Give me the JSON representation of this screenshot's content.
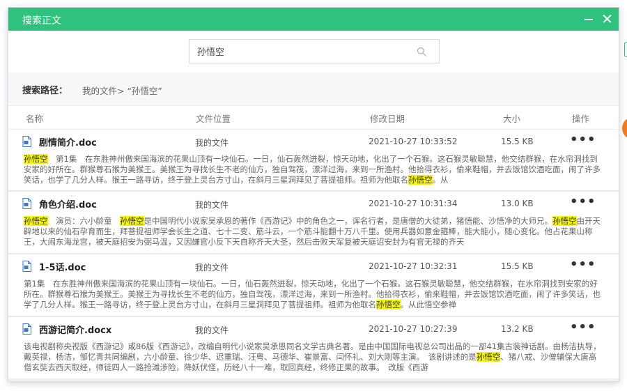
{
  "dialog": {
    "title": "搜索正文",
    "accent": "#2fc27e"
  },
  "search": {
    "value": "孙悟空",
    "placeholder": ""
  },
  "path": {
    "label": "搜索路径：",
    "value": "我的文件> “孙悟空”"
  },
  "columns": {
    "name": "名称",
    "location": "文件位置",
    "date": "修改日期",
    "size": "大小",
    "ops": "操作"
  },
  "highlight_color": "#f5f500",
  "rows": [
    {
      "name": "剧情简介.doc",
      "location": "我的文件",
      "date": "2021-10-27 10:33:52",
      "size": "15.5 KB",
      "more": "•••",
      "snippet": [
        {
          "hl": true,
          "t": "孙悟空"
        },
        {
          "hl": false,
          "t": "　第1集　在东胜神州傲来国海滨的花果山顶有一块仙石。一日，仙石轰然迸裂，惊天动地，化出了一个石猴。这石猴灵敏聪慧，他交结群猴，在水帘洞找到安家的好所在。群猴尊石猴为美猴王。美猴王为寻找长生不老的仙方，独自驾筏，漂洋过海，来到一所渔村。他拾得衣衫，偷来鞋帽，并去饭馆饮酒吃面，闹了许多笑话，也学了几分人样。猴王一路寻访，终于登上灵台方寸山，在斜月三星洞拜见了菩提祖师。祖师为他取名"
        },
        {
          "hl": true,
          "t": "孙悟空"
        },
        {
          "hl": false,
          "t": "。从"
        }
      ]
    },
    {
      "name": "角色介绍.doc",
      "location": "我的文件",
      "date": "2021-10-27 10:31:34",
      "size": "13.0 KB",
      "more": "•••",
      "snippet": [
        {
          "hl": true,
          "t": "孙悟空"
        },
        {
          "hl": false,
          "t": "　演员：六小龄童　"
        },
        {
          "hl": true,
          "t": "孙悟空"
        },
        {
          "hl": false,
          "t": "是中国明代小说家吴承恩的著作《西游记》中的角色之一，诨名行者，是唐僧的大徒弟，猪悟能、沙悟净的大师兄。"
        },
        {
          "hl": true,
          "t": "孙悟空"
        },
        {
          "hl": false,
          "t": "由开天辟地以来的仙石孕育而生，拜菩提祖师学会长生之道、七十二变、筋斗云，一个筋斗能翻十万八千里。使用兵器如意金箍棒，能大能小，随心变化。他占花果山称王，大闹东海龙宫，被天庭招安为弼马温，又因嫌官小反下天自称齐天大圣，然后击败天军复被天庭诏安封为有官无禄的齐天"
        }
      ]
    },
    {
      "name": "1-5话.doc",
      "location": "我的文件",
      "date": "2021-10-27 10:32:31",
      "size": "15.5 KB",
      "more": "•••",
      "snippet": [
        {
          "hl": false,
          "t": "第1集　在东胜神州傲来国海滨的花果山顶有一块仙石。一日，仙石轰然迸裂，惊天动地，化出了一个石猴。这石猴灵敏聪慧，他交结群猴，在水帘洞找到安家的好所在。群猴尊石猴为美猴王。美猴王为寻找长生不老的仙方，独自驾筏，漂洋过海，来到一所渔村。他拾得衣衫，偷来鞋帽，并去饭馆饮酒吃面，闹了许多笑话，也学了几分人样。猴王一路寻访，终于登上灵台方寸山，在斜月三星洞拜见了菩提祖师。祖师为他取名"
        },
        {
          "hl": true,
          "t": "孙悟空"
        },
        {
          "hl": false,
          "t": "。从此悟空参禅"
        }
      ]
    },
    {
      "name": "西游记简介.docx",
      "location": "我的文件",
      "date": "2021-10-27 10:27:39",
      "size": "13.2 KB",
      "more": "•••",
      "snippet": [
        {
          "hl": false,
          "t": "该电视剧称央视版《西游记》或86版《西游记》，改编自明代小说家吴承恩同名文学古典名著。是由中国国际电视总公司出品的一部41集古装神话剧。由杨洁执导，戴英禄，杨洁，邹忆青共同编剧，六小龄童、徐少华、迟重瑞、汪粤、马德华、崔景富、闫怀礼、刘大刚等主演。　该剧讲述的是"
        },
        {
          "hl": true,
          "t": "孙悟空"
        },
        {
          "hl": false,
          "t": "、猪八戒、沙僧辅保大唐高僧玄奘去西天取经，师徒四人一路抢滩涉险，降妖伏怪，历经八十一难，取回真经，终修正果的故事。　改版《西游"
        }
      ]
    }
  ]
}
